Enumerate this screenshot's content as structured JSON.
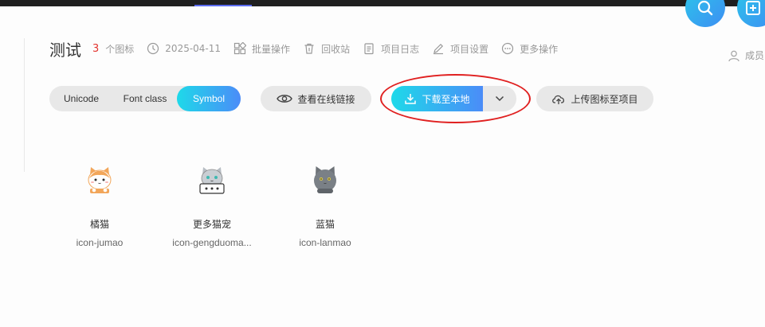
{
  "project": {
    "title": "测试",
    "icon_count": "3",
    "icon_count_unit": "个图标",
    "date": "2025-04-11",
    "actions": {
      "batch": "批量操作",
      "recycle": "回收站",
      "log": "项目日志",
      "settings": "项目设置",
      "more": "更多操作"
    },
    "members_label": "成员"
  },
  "tabs": [
    "Unicode",
    "Font class",
    "Symbol"
  ],
  "active_tab": "Symbol",
  "buttons": {
    "view_link": "查看在线链接",
    "download": "下载至本地",
    "upload": "上传图标至项目"
  },
  "icons": [
    {
      "name": "橘猫",
      "code": "icon-jumao"
    },
    {
      "name": "更多猫宠",
      "code": "icon-gengduoma..."
    },
    {
      "name": "蓝猫",
      "code": "icon-lanmao"
    }
  ],
  "colors": {
    "accent_gradient_start": "#1ed9e9",
    "accent_gradient_end": "#4b8cf8",
    "count_red": "#e3342f",
    "annotation_red": "#e02020"
  }
}
